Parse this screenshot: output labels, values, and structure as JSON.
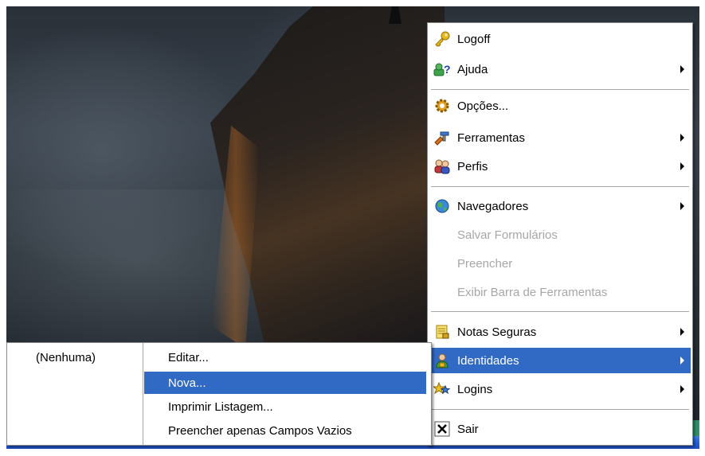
{
  "main_menu": {
    "items": [
      {
        "label": "Logoff",
        "icon": "key-icon",
        "submenu": false,
        "disabled": false
      },
      {
        "label": "Ajuda",
        "icon": "help-icon",
        "submenu": true,
        "disabled": false
      },
      {
        "label": "Opções...",
        "icon": "gear-icon",
        "submenu": false,
        "disabled": false
      },
      {
        "label": "Ferramentas",
        "icon": "tools-icon",
        "submenu": true,
        "disabled": false
      },
      {
        "label": "Perfis",
        "icon": "users-icon",
        "submenu": true,
        "disabled": false
      },
      {
        "label": "Navegadores",
        "icon": "globe-icon",
        "submenu": true,
        "disabled": false
      },
      {
        "label": "Salvar Formulários",
        "icon": "",
        "submenu": false,
        "disabled": true
      },
      {
        "label": "Preencher",
        "icon": "",
        "submenu": false,
        "disabled": true
      },
      {
        "label": "Exibir Barra de Ferramentas",
        "icon": "",
        "submenu": false,
        "disabled": true
      },
      {
        "label": "Notas Seguras",
        "icon": "note-icon",
        "submenu": true,
        "disabled": false
      },
      {
        "label": "Identidades",
        "icon": "identity-icon",
        "submenu": true,
        "disabled": false,
        "selected": true
      },
      {
        "label": "Logins",
        "icon": "star-icon",
        "submenu": true,
        "disabled": false
      },
      {
        "label": "Sair",
        "icon": "close-icon",
        "submenu": false,
        "disabled": false
      }
    ]
  },
  "identities_submenu": {
    "none_label": "(Nenhuma)",
    "items": [
      {
        "label": "Editar..."
      },
      {
        "label": "Nova...",
        "selected": true
      },
      {
        "label": "Imprimir Listagem..."
      },
      {
        "label": "Preencher apenas Campos Vazios"
      }
    ]
  },
  "colors": {
    "highlight": "#316ac5",
    "disabled_text": "#a7a7a7",
    "taskbar": "#245edc"
  }
}
